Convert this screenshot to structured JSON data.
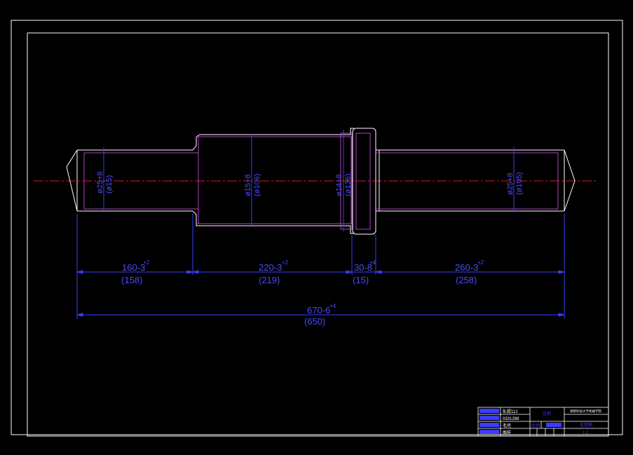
{
  "colors": {
    "background": "#000000",
    "frame": "#ffffff",
    "outline": "#ffffff",
    "hidden_lines": "#b040c0",
    "centerline": "#c82020",
    "dimension": "#3c3cff",
    "title_block_text": "#ffffff"
  },
  "dimensions": {
    "dia_left": "ø25+8",
    "dia_left_ref": "(ø15)",
    "dia_mid": "ø15+8",
    "dia_mid_ref": "(ø106)",
    "dia_flange": "ø14+8",
    "dia_flange_ref": "(ø136)",
    "dia_right": "ø25+8",
    "dia_right_ref": "(ø105)",
    "len1": "160-3",
    "len1_tol": "+2",
    "len1_ref": "(158)",
    "len2": "220-3",
    "len2_tol": "+2",
    "len2_ref": "(219)",
    "len3": "30-8",
    "len3_tol": "+4",
    "len3_ref": "(15)",
    "len4": "260-3",
    "len4_tol": "+2",
    "len4_ref": "(258)",
    "total": "670-6",
    "total_tol": "+4",
    "total_ref": "(650)"
  },
  "title_block": {
    "r1c1": "",
    "r1c2": "轧辊112",
    "r2c2": "0331288",
    "r3c2": "毛坯",
    "r4c2": "图样",
    "mid_top": "比例",
    "mid_label": "比例",
    "right_top": "湖南科技大学机械学院",
    "right_mid": "毛坯图",
    "right_bot": "1:1"
  }
}
